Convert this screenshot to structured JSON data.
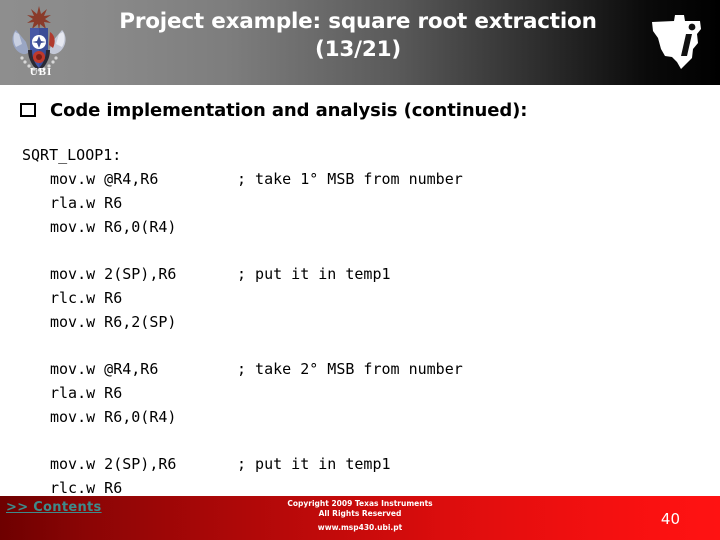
{
  "header": {
    "title_line1": "Project example: square root extraction",
    "title_line2": "(13/21)",
    "university_label": "UBI",
    "university_logo_icon": "ubi-coat-of-arms-icon",
    "vendor_logo_icon": "texas-instruments-logo-icon"
  },
  "bullet": {
    "marker_icon": "hollow-square-bullet-icon",
    "text": "Code implementation and analysis (continued):"
  },
  "code": {
    "blocks": [
      {
        "lines": [
          {
            "text": "SQRT_LOOP1:",
            "indent": false,
            "comment": ""
          },
          {
            "text": "mov.w @R4,R6",
            "indent": true,
            "comment": "; take 1° MSB from number"
          },
          {
            "text": "rla.w R6",
            "indent": true,
            "comment": ""
          },
          {
            "text": "mov.w R6,0(R4)",
            "indent": true,
            "comment": ""
          }
        ]
      },
      {
        "lines": [
          {
            "text": "mov.w 2(SP),R6",
            "indent": true,
            "comment": "; put it in temp1"
          },
          {
            "text": "rlc.w R6",
            "indent": true,
            "comment": ""
          },
          {
            "text": "mov.w R6,2(SP)",
            "indent": true,
            "comment": ""
          }
        ]
      },
      {
        "lines": [
          {
            "text": "mov.w @R4,R6",
            "indent": true,
            "comment": "; take 2° MSB from number"
          },
          {
            "text": "rla.w R6",
            "indent": true,
            "comment": ""
          },
          {
            "text": "mov.w R6,0(R4)",
            "indent": true,
            "comment": ""
          }
        ]
      },
      {
        "lines": [
          {
            "text": "mov.w 2(SP),R6",
            "indent": true,
            "comment": "; put it in temp1"
          },
          {
            "text": "rlc.w R6",
            "indent": true,
            "comment": ""
          }
        ]
      }
    ]
  },
  "footer": {
    "contents_link": ">> Contents",
    "copyright_line1": "Copyright 2009 Texas Instruments",
    "copyright_line2": "All Rights Reserved",
    "site_url": "www.msp430.ubi.pt",
    "page_number": "40"
  },
  "colors": {
    "footer_dark_red": "#6e0000",
    "footer_bright_red": "#ff1212",
    "header_gray": "#8e8e8e",
    "header_black": "#000000",
    "contents_link_teal": "#3d8b8b"
  }
}
